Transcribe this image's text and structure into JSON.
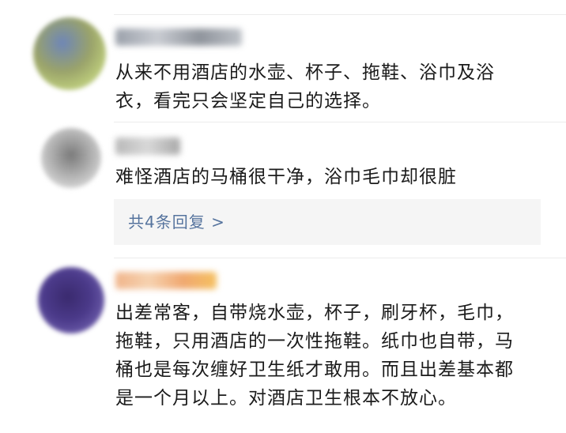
{
  "comments": [
    {
      "text_lines": [
        "从来不用酒店的水壶、杯子、拖鞋、浴巾及浴",
        "衣，看完只会坚定自己的选择。"
      ]
    },
    {
      "text_lines": [
        "难怪酒店的马桶很干净，浴巾毛巾却很脏"
      ],
      "replies_link": "共4条回复 >"
    },
    {
      "text_lines": [
        "出差常客，自带烧水壶，杯子，刷牙杯，毛巾，",
        "拖鞋，只用酒店的一次性拖鞋。纸巾也自带，马",
        "桶也是每次缠好卫生纸才敢用。而且出差基本都",
        "是一个月以上。对酒店卫生根本不放心。"
      ]
    }
  ]
}
